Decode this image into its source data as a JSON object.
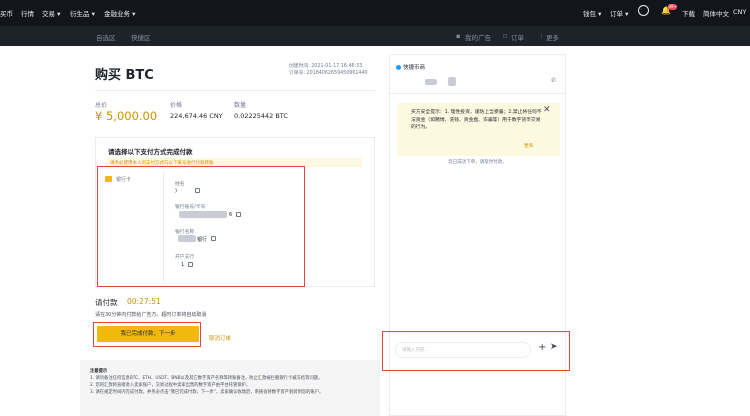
{
  "topnav": {
    "buy": "买币",
    "market": "行情",
    "trade": "交易 ▾",
    "derivatives": "衍生品 ▾",
    "finance": "金融业务 ▾",
    "wallet": "钱包 ▾",
    "orders": "订单 ▾",
    "download": "下载",
    "language": "简体中文",
    "currency": "CNY",
    "notif_count": "99+"
  },
  "subnav": {
    "self_select": "自选区",
    "express": "快捷区",
    "my_ads": "我的广告",
    "orders": "订单",
    "more": "更多"
  },
  "order": {
    "title": "购买 BTC",
    "created_label": "创建时间:",
    "created_value": "2021-01-17 16:46:33",
    "order_no_label": "订单号:",
    "order_no_value": "20184062659450961440",
    "total_label": "总价",
    "total_value": "¥ 5,000.00",
    "price_label": "价格",
    "price_value": "224,674.46 CNY",
    "qty_label": "数量",
    "qty_value": "0.02225442 BTC"
  },
  "payment": {
    "heading": "请选择以下支付方式完成付款",
    "warning": "请务必使用本人的支付方式向以下账号进行付款转账",
    "method": "银行卡",
    "name_label": "姓名",
    "name_value": ")",
    "account_label": "银行账号/卡号",
    "account_value": "6",
    "bank_label": "银行名称",
    "bank_value": "银行",
    "branch_label": "开户支行",
    "branch_value": "1"
  },
  "pay": {
    "label": "请付款",
    "timer": "00:27:51",
    "hint": "请在30分钟内付款给广告方。超时订单将自动取消",
    "done_button": "我已完成付款，下一步",
    "cancel": "取消订单"
  },
  "notes": {
    "title": "注意提示",
    "lines": [
      "1. 请勿备注任何信息BTC、ETH、USDT、BNB以及其它数字资产名称等转账备注，防止汇款被拦截银行卡被冻结等问题。",
      "2. 您的汇款将直接进入卖家账户，交易过程中卖家出售的数字资产由平台托管保护。",
      "3. 请在规定时间内完成付款，并务必点击“我已完成付款，下一步”，卖家确认收款后，系统会将数字资产划转到您的账户。"
    ]
  },
  "chat": {
    "merchant": "快捷币商",
    "safety_tip": "买方安全提示：1. 理性投资，谨防上当受骗；2.禁止将任何不法资金（如赌博、洗钱、资金盘、诈骗等）用于数字货币交易的行为。",
    "more": "更多",
    "system_msg": "您已成功下单，请及时付款。",
    "input_placeholder": "请输入内容..."
  },
  "colors": {
    "accent": "#f0b90b",
    "highlight": "#e5483d",
    "price_text": "#c99400"
  }
}
